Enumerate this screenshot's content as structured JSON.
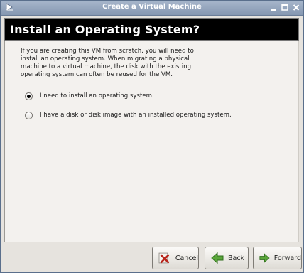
{
  "window": {
    "title": "Create a Virtual Machine"
  },
  "header": {
    "title": "Install an Operating System?"
  },
  "content": {
    "description_lines": [
      "If you are creating this VM from scratch, you will need to",
      "install an operating system.  When migrating a physical",
      "machine to a virtual machine, the disk with the existing",
      "operating system can often be reused for the VM."
    ],
    "options": [
      {
        "label": "I need to install an operating system.",
        "selected": true
      },
      {
        "label": "I have a disk or disk image with an installed operating system.",
        "selected": false
      }
    ]
  },
  "buttons": {
    "cancel": {
      "label": "Cancel",
      "icon": "cancel-x-icon"
    },
    "back": {
      "label": "Back",
      "icon": "back-arrow-icon"
    },
    "forward": {
      "label": "Forward",
      "icon": "forward-arrow-icon"
    }
  },
  "colors": {
    "titlebar": "#8f9fb8",
    "header_band": "#000000",
    "arrow_green": "#4a9a2e",
    "cancel_red": "#c0392b"
  }
}
